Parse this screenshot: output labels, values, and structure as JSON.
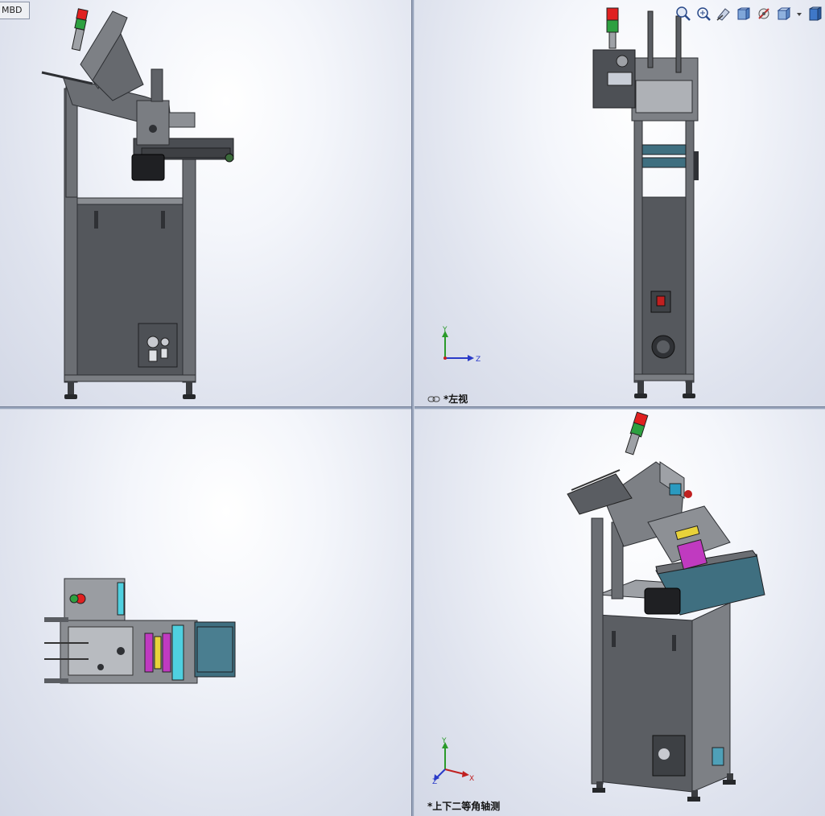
{
  "window": {
    "tab_label": "MBD"
  },
  "toolbar": {
    "tools": [
      "zoom-to-fit-icon",
      "zoom-to-area-icon",
      "previous-view-icon",
      "section-view-icon",
      "dynamic-annotation-icon",
      "view-orientation-icon",
      "display-style-icon"
    ]
  },
  "viewports": {
    "top_right": {
      "label": "*左视"
    },
    "bottom_right": {
      "label": "*上下二等角轴测"
    }
  },
  "triad": {
    "y": "Y",
    "z": "Z",
    "x": "X"
  },
  "colors": {
    "frame": "#6b6e73",
    "frame_dark": "#3e4044",
    "panel": "#54575c",
    "belt": "#3f6f80",
    "magenta": "#c03ac0",
    "cyan": "#4fd0e0",
    "yellow": "#e8d23a",
    "signal_red": "#e02020",
    "signal_green": "#2da040"
  }
}
